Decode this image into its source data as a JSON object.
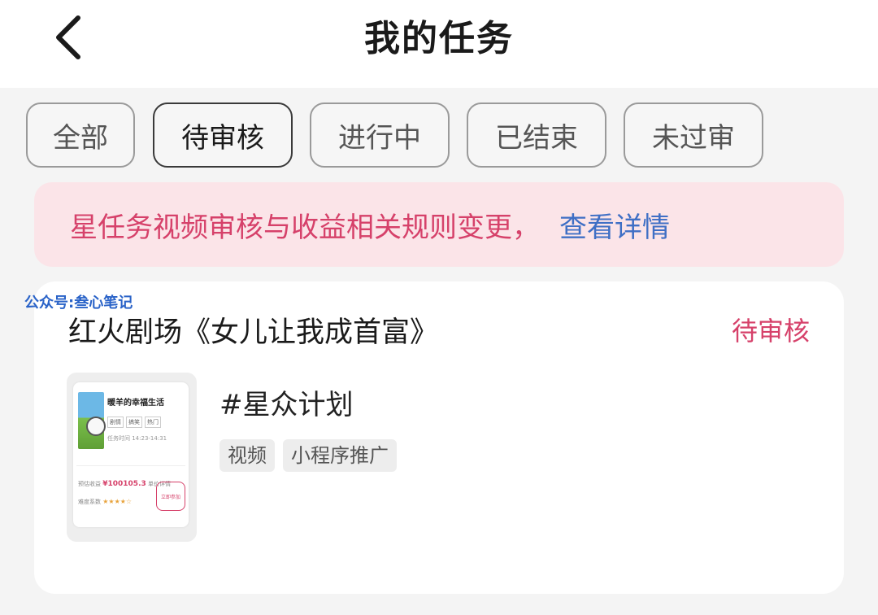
{
  "header": {
    "title": "我的任务",
    "back_icon": "chevron-left-icon"
  },
  "tabs": [
    {
      "label": "全部",
      "active": false
    },
    {
      "label": "待审核",
      "active": true
    },
    {
      "label": "进行中",
      "active": false
    },
    {
      "label": "已结束",
      "active": false
    },
    {
      "label": "未过审",
      "active": false
    }
  ],
  "notice": {
    "text": "星任务视频审核与收益相关规则变更，",
    "link": "查看详情",
    "text_color": "#d6416a",
    "link_color": "#3f6fc5",
    "background": "#fbe4e8"
  },
  "watermark": "公众号:叁心笔记",
  "task": {
    "title": "红火剧场《女儿让我成首富》",
    "status": "待审核",
    "status_color": "#d6416a",
    "plan_name": "#星众计划",
    "tags": [
      "视频",
      "小程序推广"
    ],
    "thumbnail": {
      "title": "暖羊的幸福生活",
      "tags": [
        "剧情",
        "搞笑",
        "热门"
      ],
      "meta": "任务时间 14:23-14:31",
      "row1_label": "预估收益",
      "price": "¥100105.3",
      "row1_suffix": "单价详情",
      "row2_label": "难度系数",
      "stars": "★★★★☆",
      "button": "立即参加"
    }
  }
}
